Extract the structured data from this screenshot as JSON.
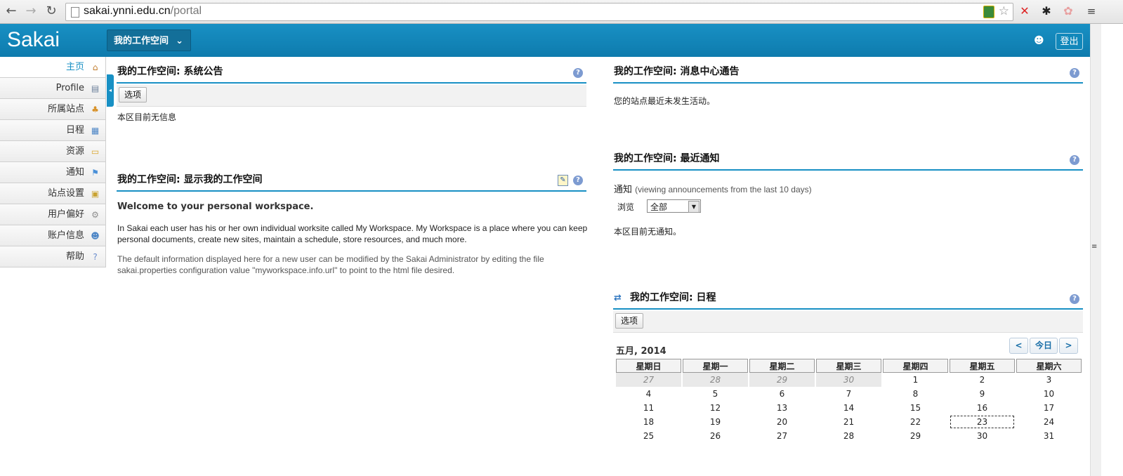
{
  "browser": {
    "url_host": "sakai.ynni.edu.cn",
    "url_path": "/portal"
  },
  "header": {
    "logo": "Sakai",
    "workspace_button": "我的工作空间",
    "logout": "登出"
  },
  "sidebar": {
    "items": [
      {
        "label": "主页",
        "icon": "home-icon",
        "glyph": "⌂",
        "active": true
      },
      {
        "label": "Profile",
        "icon": "profile-card-icon",
        "glyph": "▤"
      },
      {
        "label": "所属站点",
        "icon": "sites-icon",
        "glyph": "♣"
      },
      {
        "label": "日程",
        "icon": "calendar-icon",
        "glyph": "▦"
      },
      {
        "label": "资源",
        "icon": "folder-icon",
        "glyph": "▭"
      },
      {
        "label": "通知",
        "icon": "announcement-icon",
        "glyph": "⚑"
      },
      {
        "label": "站点设置",
        "icon": "site-settings-icon",
        "glyph": "▣"
      },
      {
        "label": "用户偏好",
        "icon": "gear-icon",
        "glyph": "⚙"
      },
      {
        "label": "账户信息",
        "icon": "account-icon",
        "glyph": "☻"
      },
      {
        "label": "帮助",
        "icon": "help-icon",
        "glyph": "?"
      }
    ]
  },
  "system_notice": {
    "title": "我的工作空间: 系统公告",
    "options_btn": "选项",
    "empty": "本区目前无信息"
  },
  "workspace_info": {
    "title": "我的工作空间: 显示我的工作空间",
    "heading": "Welcome to your personal workspace.",
    "para1": "In Sakai each user has his or her own individual worksite called My Workspace. My Workspace is a place where you can keep personal documents, create new sites, maintain a schedule, store resources, and much more.",
    "para2": "The default information displayed here for a new user can be modified by the Sakai Administrator by editing the file sakai.properties configuration value \"myworkspace.info.url\" to point to the html file desired."
  },
  "message_center": {
    "title": "我的工作空间: 消息中心通告",
    "text": "您的站点最近未发生活动。"
  },
  "recent_announcements": {
    "title": "我的工作空间: 最近通知",
    "label": "通知",
    "sublabel": "(viewing announcements from the last 10 days)",
    "browse_label": "浏览",
    "browse_value": "全部",
    "empty": "本区目前无通知。"
  },
  "schedule": {
    "title": "我的工作空间: 日程",
    "options_btn": "选项",
    "month": "五月, 2014",
    "prev_btn": "<",
    "today_btn": "今日",
    "next_btn": ">",
    "weekdays": [
      "星期日",
      "星期一",
      "星期二",
      "星期三",
      "星期四",
      "星期五",
      "星期六"
    ],
    "weeks": [
      [
        "27",
        "28",
        "29",
        "30",
        "1",
        "2",
        "3"
      ],
      [
        "4",
        "5",
        "6",
        "7",
        "8",
        "9",
        "10"
      ],
      [
        "11",
        "12",
        "13",
        "14",
        "15",
        "16",
        "17"
      ],
      [
        "18",
        "19",
        "20",
        "21",
        "22",
        "23",
        "24"
      ],
      [
        "25",
        "26",
        "27",
        "28",
        "29",
        "30",
        "31"
      ]
    ],
    "prev_month_days_in_first_week": 4,
    "today": "23"
  }
}
